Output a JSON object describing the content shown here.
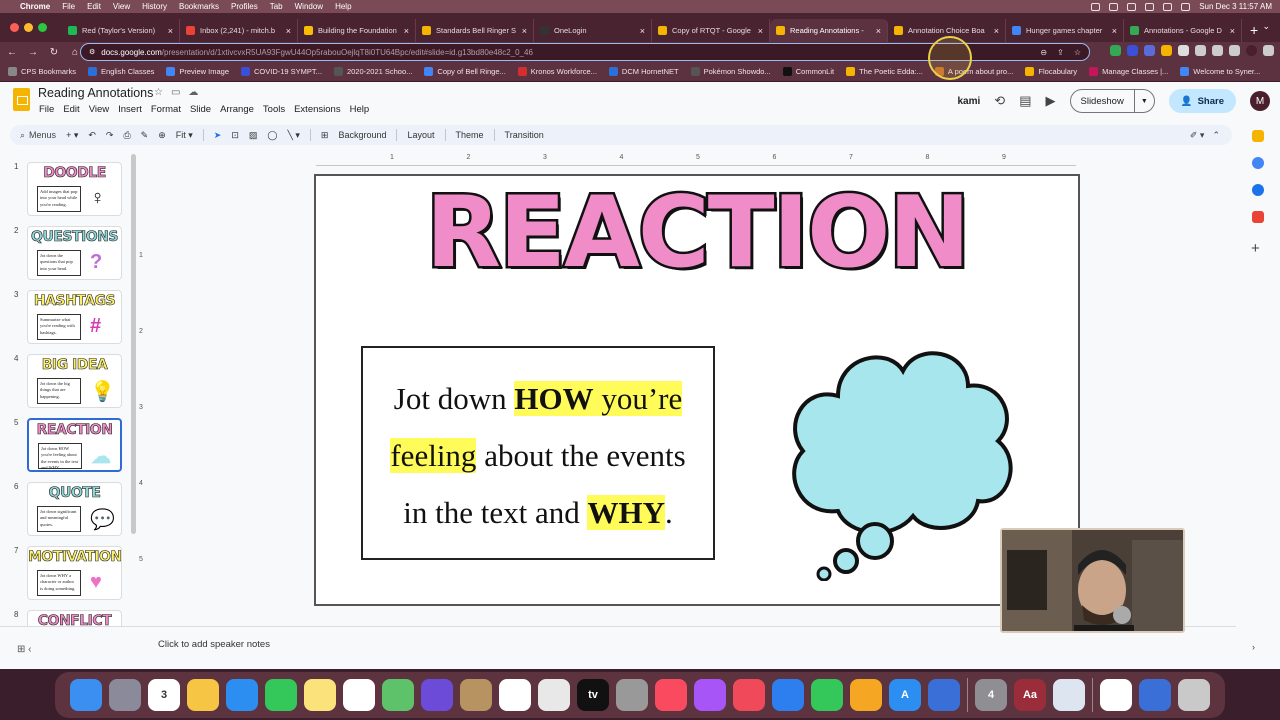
{
  "menubar": {
    "app": "Chrome",
    "items": [
      "File",
      "Edit",
      "View",
      "History",
      "Bookmarks",
      "Profiles",
      "Tab",
      "Window",
      "Help"
    ],
    "clock": "Sun Dec 3  11:57 AM"
  },
  "tabs": [
    {
      "title": "Red (Taylor's Version)",
      "color": "#1db954"
    },
    {
      "title": "Inbox (2,241) - mitch.b",
      "color": "#ea4335"
    },
    {
      "title": "Building the Foundation",
      "color": "#fbbc04"
    },
    {
      "title": "Standards Bell Ringer S",
      "color": "#f4b400"
    },
    {
      "title": "OneLogin",
      "color": "#333333"
    },
    {
      "title": "Copy of RTQT - Google",
      "color": "#f4b400"
    },
    {
      "title": "Reading Annotations -",
      "color": "#f4b400",
      "active": true
    },
    {
      "title": "Annotation Choice Boa",
      "color": "#f4b400"
    },
    {
      "title": "Hunger games chapter",
      "color": "#4285f4"
    },
    {
      "title": "Annotations - Google D",
      "color": "#34a853"
    }
  ],
  "address": {
    "host": "docs.google.com",
    "path": "/presentation/d/1xtivcvxR5UA93FgwU44Op5rabouOejlqT8i0TU64Bpc/edit#slide=id.g13bd80e48c2_0_46"
  },
  "bookmarks": [
    "CPS Bookmarks",
    "English Classes",
    "Preview Image",
    "COVID-19 SYMPT...",
    "2020-2021 Schoo...",
    "Copy of Bell Ringe...",
    "Kronos Workforce...",
    "DCM HornetNET",
    "Pokémon Showdo...",
    "CommonLit",
    "The Poetic Edda:...",
    "A poem about pro...",
    "Flocabulary",
    "Manage Classes |...",
    "Welcome to Syner..."
  ],
  "doc": {
    "title": "Reading Annotations",
    "menus": [
      "File",
      "Edit",
      "View",
      "Insert",
      "Format",
      "Slide",
      "Arrange",
      "Tools",
      "Extensions",
      "Help"
    ],
    "kami": "kami",
    "slideshow": "Slideshow",
    "share": "Share",
    "avatar": "M"
  },
  "toolbar": {
    "menus": "Menus",
    "zoom": "Fit",
    "background": "Background",
    "layout": "Layout",
    "theme": "Theme",
    "transition": "Transition"
  },
  "ruler": {
    "h": [
      "1",
      "2",
      "3",
      "4",
      "5",
      "6",
      "7",
      "8",
      "9"
    ],
    "v": [
      "1",
      "2",
      "3",
      "4",
      "5"
    ]
  },
  "thumbnails": [
    {
      "num": "1",
      "title": "DOODLE",
      "color": "#f08cc8",
      "text": "Add images that pop into your head while you're reading.",
      "art": "♀",
      "art_color": "#111"
    },
    {
      "num": "2",
      "title": "QUESTIONS",
      "color": "#8fd6d8",
      "text": "Jot down the questions that pop into your head.",
      "art": "?",
      "art_color": "#c36ad9"
    },
    {
      "num": "3",
      "title": "HASHTAGS",
      "color": "#fff26b",
      "text": "Summarize what you're reading with hashtags.",
      "art": "#",
      "art_color": "#d43bb5"
    },
    {
      "num": "4",
      "title": "BIG IDEA",
      "color": "#fff26b",
      "text": "Jot down the big things that are happening.",
      "art": "💡",
      "art_color": "#f4b400"
    },
    {
      "num": "5",
      "title": "REACTION",
      "color": "#f08cc8",
      "text": "Jot down HOW you're feeling about the events in the text and WHY.",
      "art": "☁",
      "art_color": "#a8e6ee",
      "active": true
    },
    {
      "num": "6",
      "title": "QUOTE",
      "color": "#8fd6d8",
      "text": "Jot down significant and meaningful quotes.",
      "art": "💬",
      "art_color": "#b86ad9"
    },
    {
      "num": "7",
      "title": "MOTIVATION",
      "color": "#fff26b",
      "text": "Jot down WHY a character or author is doing something.",
      "art": "♥",
      "art_color": "#ef6fc6"
    },
    {
      "num": "8",
      "title": "CONFLICT",
      "color": "#f08cc8",
      "text": "",
      "art": "",
      "art_color": "#333"
    }
  ],
  "slide": {
    "title": "REACTION",
    "line1_a": "Jot down ",
    "line1_b": "HOW",
    "line1_c": " you’re",
    "line2_a": "feeling",
    "line2_b": " about the events",
    "line3_a": "in the text and ",
    "line3_b": "WHY",
    "line3_c": "."
  },
  "notes": {
    "placeholder": "Click to add speaker notes"
  },
  "dock": [
    {
      "name": "finder",
      "color": "#3b8ff0",
      "label": ""
    },
    {
      "name": "launchpad",
      "color": "#8a8a9a",
      "label": ""
    },
    {
      "name": "calendar",
      "color": "#ffffff",
      "label": "3"
    },
    {
      "name": "photos",
      "color": "#f6c544",
      "label": ""
    },
    {
      "name": "safari",
      "color": "#2b8ef0",
      "label": ""
    },
    {
      "name": "messages",
      "color": "#34c759",
      "label": ""
    },
    {
      "name": "notes",
      "color": "#fce27a",
      "label": ""
    },
    {
      "name": "freeform",
      "color": "#ffffff",
      "label": ""
    },
    {
      "name": "maps",
      "color": "#5ec26a",
      "label": ""
    },
    {
      "name": "imovie",
      "color": "#6d4bd9",
      "label": ""
    },
    {
      "name": "contacts",
      "color": "#b79362",
      "label": ""
    },
    {
      "name": "reminders",
      "color": "#ffffff",
      "label": ""
    },
    {
      "name": "chrome",
      "color": "#e8e8e8",
      "label": ""
    },
    {
      "name": "apple-tv",
      "color": "#111111",
      "label": "tv"
    },
    {
      "name": "dvd",
      "color": "#999999",
      "label": ""
    },
    {
      "name": "music",
      "color": "#fa4a5f",
      "label": ""
    },
    {
      "name": "podcasts",
      "color": "#a855f7",
      "label": ""
    },
    {
      "name": "news",
      "color": "#f04a5a",
      "label": ""
    },
    {
      "name": "keynote",
      "color": "#2d7ff0",
      "label": ""
    },
    {
      "name": "numbers",
      "color": "#34c759",
      "label": ""
    },
    {
      "name": "pages",
      "color": "#f5a623",
      "label": ""
    },
    {
      "name": "app-store",
      "color": "#2b8ef0",
      "label": "A"
    },
    {
      "name": "custom-app",
      "color": "#3b6fd8",
      "label": ""
    },
    {
      "name": "system-settings",
      "color": "#8e8e93",
      "label": "4"
    },
    {
      "name": "dictionary",
      "color": "#9b2d3b",
      "label": "Aa"
    },
    {
      "name": "preview",
      "color": "#dde6f0",
      "label": ""
    },
    {
      "name": "document",
      "color": "#ffffff",
      "label": ""
    },
    {
      "name": "custom-app-2",
      "color": "#3b6fd8",
      "label": ""
    },
    {
      "name": "trash",
      "color": "#c9c9c9",
      "label": ""
    }
  ]
}
